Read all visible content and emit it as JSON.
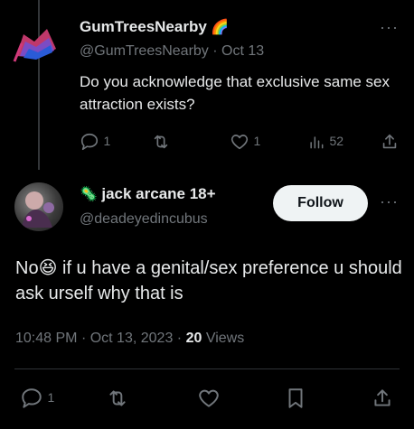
{
  "reply_to": {
    "display_name": "GumTreesNearby",
    "name_emoji": "🌈",
    "handle": "@GumTreesNearby",
    "date": "Oct 13",
    "text": "Do you acknowledge that exclusive same sex attraction exists?",
    "counts": {
      "replies": "1",
      "retweets": "",
      "likes": "1",
      "views": "52"
    }
  },
  "tweet": {
    "badge_emoji": "🦠",
    "display_name": "jack arcane 18+",
    "handle": "@deadeyedincubus",
    "follow_label": "Follow",
    "text_before_emoji": "No",
    "emoji": "😆",
    "text_after_emoji": " if u have a genital/sex preference u should ask urself why that is",
    "time": "10:48 PM",
    "date": "Oct 13, 2023",
    "views_count": "20",
    "views_label": "Views",
    "reply_count": "1"
  },
  "more_label": "···",
  "separator": "·"
}
